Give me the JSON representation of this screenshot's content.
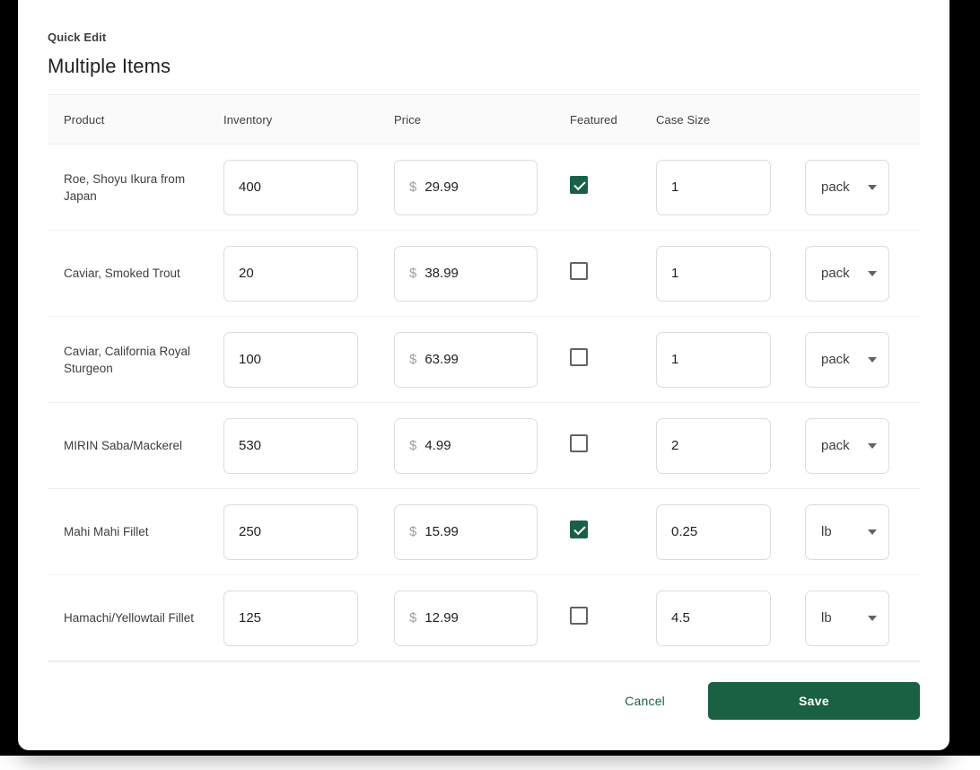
{
  "dialog": {
    "eyebrow": "Quick Edit",
    "title": "Multiple Items"
  },
  "table": {
    "headers": {
      "product": "Product",
      "inventory": "Inventory",
      "price": "Price",
      "featured": "Featured",
      "case_size": "Case Size",
      "unit": ""
    },
    "currency_symbol": "$",
    "rows": [
      {
        "product": "Roe, Shoyu Ikura from Japan",
        "inventory": "400",
        "price": "29.99",
        "featured": true,
        "case_size": "1",
        "unit": "pack"
      },
      {
        "product": "Caviar, Smoked Trout",
        "inventory": "20",
        "price": "38.99",
        "featured": false,
        "case_size": "1",
        "unit": "pack"
      },
      {
        "product": "Caviar, California Royal Sturgeon",
        "inventory": "100",
        "price": "63.99",
        "featured": false,
        "case_size": "1",
        "unit": "pack"
      },
      {
        "product": "MIRIN Saba/Mackerel",
        "inventory": "530",
        "price": "4.99",
        "featured": false,
        "case_size": "2",
        "unit": "pack"
      },
      {
        "product": "Mahi Mahi Fillet",
        "inventory": "250",
        "price": "15.99",
        "featured": true,
        "case_size": "0.25",
        "unit": "lb"
      },
      {
        "product": "Hamachi/Yellowtail Fillet",
        "inventory": "125",
        "price": "12.99",
        "featured": false,
        "case_size": "4.5",
        "unit": "lb"
      }
    ]
  },
  "footer": {
    "cancel_label": "Cancel",
    "save_label": "Save"
  },
  "colors": {
    "accent_green": "#1a6043",
    "cancel_green": "#1c6144",
    "checkbox_checked": "#1a6049",
    "border": "#dcdcdc",
    "divider": "#eeeeee",
    "header_row_bg": "#fafafa",
    "currency_gray": "#9e9e9e",
    "text_primary": "#202124",
    "text_secondary": "#3c4043"
  }
}
